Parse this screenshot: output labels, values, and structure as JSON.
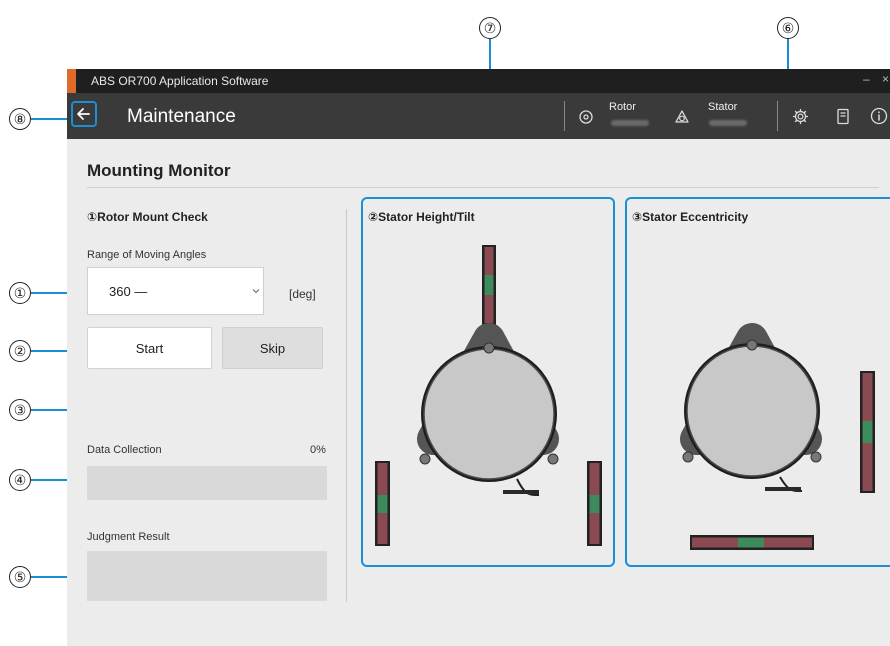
{
  "callouts": {
    "c1": "①",
    "c2": "②",
    "c3": "③",
    "c4": "④",
    "c5": "⑤",
    "c6": "⑥",
    "c7": "⑦",
    "c8": "⑧"
  },
  "window": {
    "title": "ABS OR700 Application Software",
    "minimize": "–",
    "close": "×"
  },
  "header": {
    "page_title": "Maintenance",
    "rotor_label": "Rotor",
    "stator_label": "Stator",
    "icons": [
      "back-arrow-icon",
      "rotor-icon",
      "stator-icon",
      "settings-gear-icon",
      "manual-book-icon",
      "info-icon"
    ]
  },
  "main": {
    "section_title": "Mounting Monitor",
    "rotor_check": {
      "title": "①Rotor Mount Check",
      "range_label": "Range of Moving Angles",
      "range_value": "360 —",
      "range_unit": "[deg]",
      "start_label": "Start",
      "skip_label": "Skip",
      "data_collection_label": "Data Collection",
      "data_collection_percent": "0%",
      "data_collection_progress": 0,
      "judgment_label": "Judgment Result"
    },
    "stator_height": {
      "title": "②Stator Height/Tilt"
    },
    "stator_ecc": {
      "title": "③Stator Eccentricity"
    }
  },
  "colors": {
    "accent_blue": "#1a8fd6",
    "header_bg": "#3a3a3a",
    "titlebar_bg": "#1f1f1f",
    "titlebar_accent": "#e06a2a",
    "gauge_bar": "#8a4a52",
    "gauge_center": "#3d8a5c"
  }
}
